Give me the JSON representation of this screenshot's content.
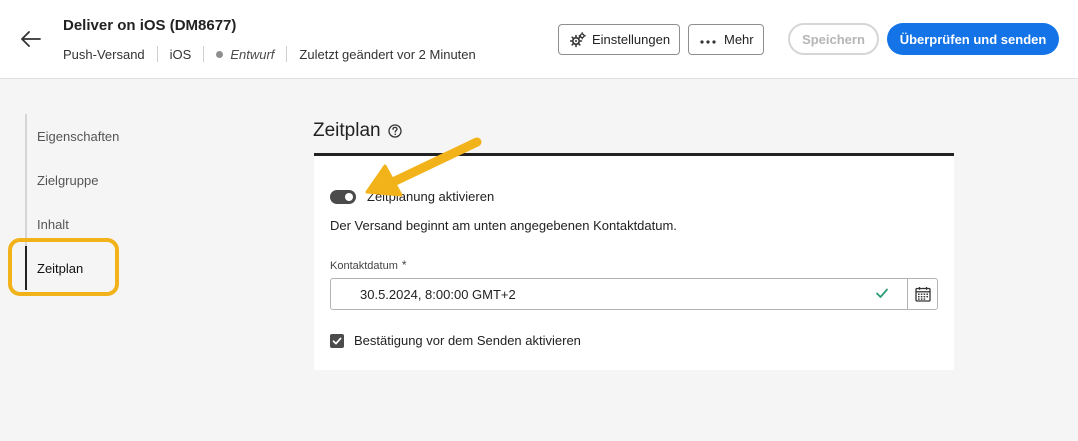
{
  "header": {
    "title": "Deliver on iOS (DM8677)",
    "meta": {
      "channel": "Push-Versand",
      "platform": "iOS",
      "status": "Entwurf",
      "modified": "Zuletzt geändert vor 2 Minuten"
    },
    "buttons": {
      "settings": "Einstellungen",
      "more": "Mehr",
      "save": "Speichern",
      "review_send": "Überprüfen und senden"
    }
  },
  "sidebar": {
    "items": [
      {
        "label": "Eigenschaften"
      },
      {
        "label": "Zielgruppe"
      },
      {
        "label": "Inhalt"
      },
      {
        "label": "Zeitplan"
      }
    ],
    "active": "Zeitplan"
  },
  "main": {
    "section_title": "Zeitplan",
    "toggle_label": "Zeitplanung aktivieren",
    "toggle_on": true,
    "description": "Der Versand beginnt am unten angegebenen Kontaktdatum.",
    "field_label": "Kontaktdatum",
    "required_mark": "*",
    "date_value": "30.5.2024, 8:00:00 GMT+2",
    "checkbox_label": "Bestätigung vor dem Senden aktivieren",
    "checkbox_checked": true
  },
  "colors": {
    "accent": "#1473e6",
    "highlight": "#f2b31a",
    "valid": "#2d9d78"
  },
  "icons": [
    "back-arrow-icon",
    "gear-icon",
    "more-dots-icon",
    "help-icon",
    "checkmark-icon",
    "calendar-icon",
    "annotation-arrow"
  ]
}
